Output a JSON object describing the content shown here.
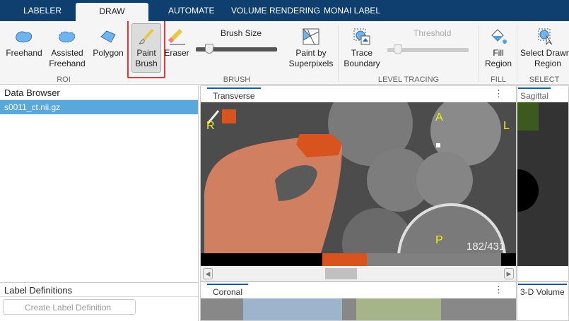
{
  "tabs": [
    {
      "label": "LABELER"
    },
    {
      "label": "DRAW"
    },
    {
      "label": "AUTOMATE"
    },
    {
      "label": "VOLUME RENDERING"
    },
    {
      "label": "MONAI LABEL"
    }
  ],
  "toolstrip": {
    "roi": {
      "label": "ROI",
      "freehand": "Freehand",
      "assisted1": "Assisted",
      "assisted2": "Freehand",
      "polygon": "Polygon"
    },
    "brush": {
      "label": "BRUSH",
      "paint1": "Paint",
      "paint2": "Brush",
      "eraser": "Eraser",
      "size": "Brush Size",
      "size_value": 0.15,
      "super1": "Paint by",
      "super2": "Superpixels"
    },
    "level": {
      "label": "LEVEL TRACING",
      "trace1": "Trace",
      "trace2": "Boundary",
      "threshold": "Threshold",
      "threshold_value": 0.1
    },
    "fill": {
      "label": "FILL",
      "fill1": "Fill",
      "fill2": "Region"
    },
    "select": {
      "label": "SELECT",
      "sel1": "Select Drawn",
      "sel2": "Region"
    },
    "highlight_color": "#e8343c"
  },
  "data_browser": {
    "title": "Data Browser",
    "items": [
      "s0011_ct.nii.gz"
    ]
  },
  "label_definitions": {
    "title": "Label Definitions",
    "create": "Create Label Definition"
  },
  "views": {
    "transverse": {
      "title": "Transverse",
      "orient": {
        "r": "R",
        "a": "A",
        "l": "L",
        "p": "P"
      },
      "slice": "182/431",
      "label_color": "#d9531e"
    },
    "sagittal": {
      "title": "Sagittal"
    },
    "coronal": {
      "title": "Coronal"
    },
    "volume": {
      "title": "3-D Volume"
    }
  }
}
